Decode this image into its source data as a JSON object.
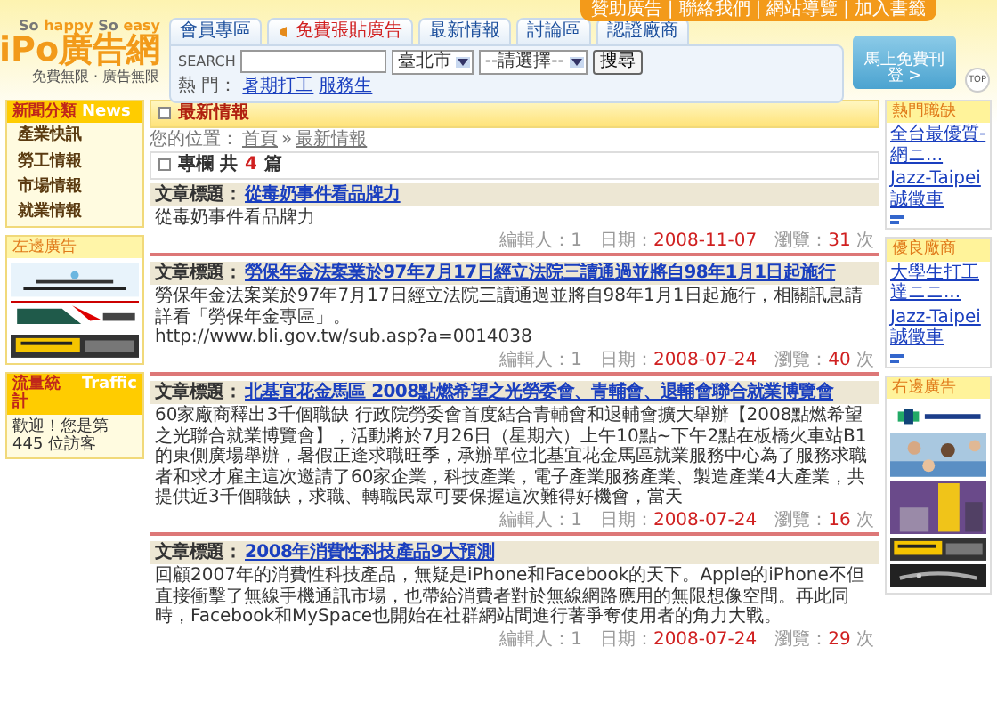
{
  "header": {
    "tagline_parts": [
      "So ",
      "happy",
      " So ",
      "easy"
    ],
    "logo_latin": "iPo",
    "logo_cjk": "廣告網",
    "slogan": "免費無限 · 廣告無限",
    "top_links": [
      "贊助廣告",
      "聯絡我們",
      "網站導覽",
      "加入書籤"
    ],
    "top_link_separator": "|",
    "tabs": [
      {
        "label": "會員專區",
        "kind": "normal"
      },
      {
        "label": "免費張貼廣告",
        "kind": "promo"
      },
      {
        "label": "最新情報",
        "kind": "normal"
      },
      {
        "label": "討論區",
        "kind": "normal"
      },
      {
        "label": "認證廠商",
        "kind": "normal"
      }
    ],
    "search": {
      "label": "SEARCH",
      "city": "臺北市",
      "category": "--請選擇--",
      "button": "搜尋",
      "hot_label": "熱 門：",
      "hot_links": [
        "暑期打工",
        "服務生"
      ]
    },
    "post_button": "馬上免費刊登 >",
    "top_button": "TOP"
  },
  "left": {
    "news_box": {
      "title": "新聞分類",
      "title_en": "News",
      "items": [
        "產業快訊",
        "勞工情報",
        "市場情報",
        "就業情報"
      ]
    },
    "ads_box": {
      "title": "左邊廣告"
    },
    "traffic_box": {
      "title": "流量統計",
      "title_en": "Traffic",
      "text": "歡迎！您是第 445 位訪客"
    }
  },
  "main": {
    "title": "最新情報",
    "breadcrumb": {
      "label": "您的位置：",
      "links": [
        "首頁",
        "最新情報"
      ],
      "separator": "»"
    },
    "count": {
      "before": "專欄 共",
      "number": "4",
      "after": "篇"
    },
    "articles": [
      {
        "label": "文章標題：",
        "title": "從毒奶事件看品牌力",
        "body": [
          "從毒奶事件看品牌力"
        ],
        "editor": "編輯人：1",
        "date_label": "日期：",
        "date": "2008-11-07",
        "views_label": "瀏覽：",
        "views": "31",
        "views_unit": "次"
      },
      {
        "label": "文章標題：",
        "title": "勞保年金法案業於97年7月17日經立法院三讀通過並將自98年1月1日起施行",
        "body": [
          "勞保年金法案業於97年7月17日經立法院三讀通過並將自98年1月1日起施行，相關訊息請詳看「勞保年金專區」。",
          "http://www.bli.gov.tw/sub.asp?a=0014038"
        ],
        "editor": "編輯人：1",
        "date_label": "日期：",
        "date": "2008-07-24",
        "views_label": "瀏覽：",
        "views": "40",
        "views_unit": "次"
      },
      {
        "label": "文章標題：",
        "title": "北基宜花金馬區 2008點燃希望之光勞委會、青輔會、退輔會聯合就業博覽會",
        "body": [
          "60家廠商釋出3千個職缺 行政院勞委會首度結合青輔會和退輔會擴大舉辦【2008點燃希望之光聯合就業博覽會】，活動將於7月26日（星期六）上午10點~下午2點在板橋火車站B1的東側廣場舉辦，暑假正逢求職旺季，承辦單位北基宜花金馬區就業服務中心為了服務求職者和求才雇主這次邀請了60家企業，科技產業，電子產業服務產業、製造產業4大產業，共提供近3千個職缺，求職、轉職民眾可要保握這次難得好機會，當天"
        ],
        "editor": "編輯人：1",
        "date_label": "日期：",
        "date": "2008-07-24",
        "views_label": "瀏覽：",
        "views": "16",
        "views_unit": "次"
      },
      {
        "label": "文章標題：",
        "title": "2008年消費性科技產品9大預測",
        "body": [
          "回顧2007年的消費性科技產品，無疑是iPhone和Facebook的天下。Apple的iPhone不但直接衝擊了無線手機通訊市場，也帶給消費者對於無線網路應用的無限想像空間。再此同時，Facebook和MySpace也開始在社群網站間進行著爭奪使用者的角力大戰。"
        ],
        "editor": "編輯人：1",
        "date_label": "日期：",
        "date": "2008-07-24",
        "views_label": "瀏覽：",
        "views": "29",
        "views_unit": "次"
      }
    ]
  },
  "right": {
    "boxes": [
      {
        "title": "熱門職缺",
        "links": [
          "全台最優質-網ニ...",
          "Jazz-Taipei誠徵車"
        ]
      },
      {
        "title": "優良廠商",
        "links": [
          "大學生打工達ニニ...",
          "Jazz-Taipei誠徵車"
        ]
      }
    ],
    "ads_title": "右邊廣告"
  }
}
